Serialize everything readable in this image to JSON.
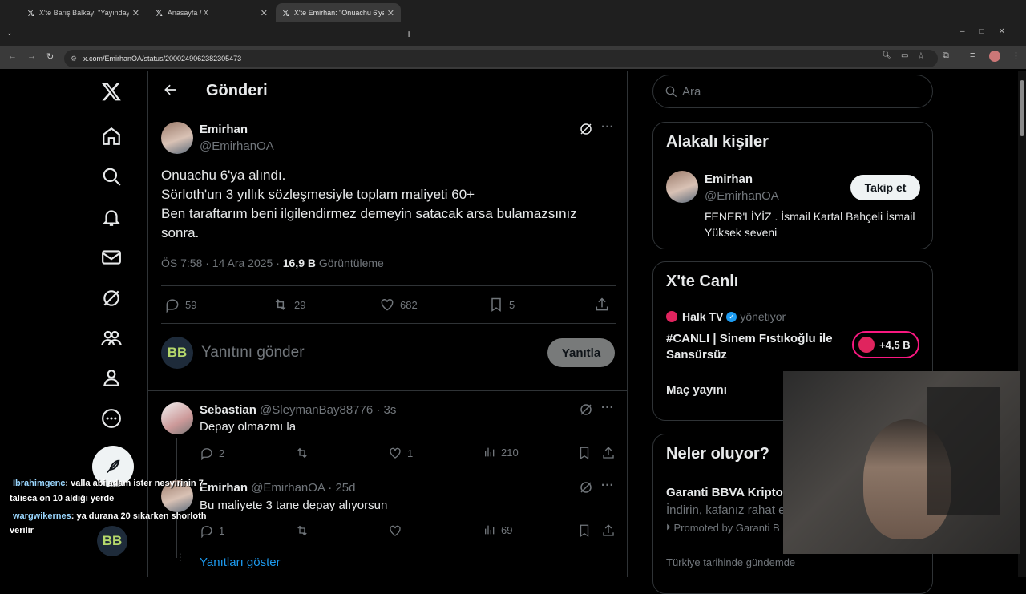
{
  "browser": {
    "tabs": [
      {
        "title": "X'te Barış Balkay: \"Yayındayım. (",
        "active": false
      },
      {
        "title": "Anasayfa / X",
        "active": false
      },
      {
        "title": "X'te Emirhan: \"Onuachu 6'ya alı",
        "active": true
      }
    ],
    "url": "x.com/EmirhanOA/status/2000249062382305473"
  },
  "header": {
    "title": "Gönderi"
  },
  "post": {
    "display_name": "Emirhan",
    "handle": "@EmirhanOA",
    "lines": [
      "Onuachu 6'ya alındı.",
      "Sörloth'un 3 yıllık sözleşmesiyle toplam maliyeti 60+",
      "Ben taraftarım beni ilgilendirmez demeyin satacak arsa bulamazsınız sonra."
    ],
    "time": "ÖS 7:58 · 14 Ara 2025 ·",
    "views_count": "16,9 B",
    "views_label": "Görüntüleme",
    "replies": "59",
    "reposts": "29",
    "likes": "682",
    "bookmarks": "5"
  },
  "composer": {
    "placeholder": "Yanıtını gönder",
    "button": "Yanıtla"
  },
  "replies": [
    {
      "name": "Sebastian",
      "handle": "@SleymanBay88776 · 3s",
      "text": "Depay olmazmı la",
      "replies": "2",
      "reposts": "",
      "likes": "1",
      "views": "210"
    },
    {
      "name": "Emirhan",
      "handle": "@EmirhanOA · 25d",
      "text": "Bu maliyete 3 tane depay alıyorsun",
      "replies": "1",
      "reposts": "",
      "likes": "",
      "views": "69"
    }
  ],
  "show_replies": "Yanıtları göster",
  "search": {
    "placeholder": "Ara"
  },
  "related": {
    "title": "Alakalı kişiler",
    "name": "Emirhan",
    "handle": "@EmirhanOA",
    "follow": "Takip et",
    "bio": "FENER'LİYİZ . İsmail Kartal Bahçeli İsmail Yüksek seveni"
  },
  "live": {
    "title": "X'te Canlı",
    "host": "Halk TV",
    "host_suffix": "yönetiyor",
    "headline": "#CANLI | Sinem Fıstıkoğlu ile Sansürsüz",
    "listeners": "+4,5 B",
    "next": "Maç yayını"
  },
  "trends": {
    "title": "Neler oluyor?",
    "ad_title": "Garanti BBVA Kripto",
    "ad_text": "İndirin, kafanız rahat e",
    "ad_promoted": "Promoted by Garanti B",
    "history": "Türkiye tarihinde gündemde"
  },
  "chat": [
    {
      "user": "Ibrahimgenc",
      "msg": ": valla abi adam ister nesyirinin 7",
      "msg2": "talisca on 10 aldığı yerde"
    },
    {
      "user": "wargwikernes",
      "msg": ": ya durana 20 sıkarken shorloth",
      "msg2": "verilir"
    }
  ],
  "colors": {
    "accent": "#1d9bf0",
    "background": "#000000",
    "border": "#2f3336",
    "live_pink": "#f91880"
  }
}
